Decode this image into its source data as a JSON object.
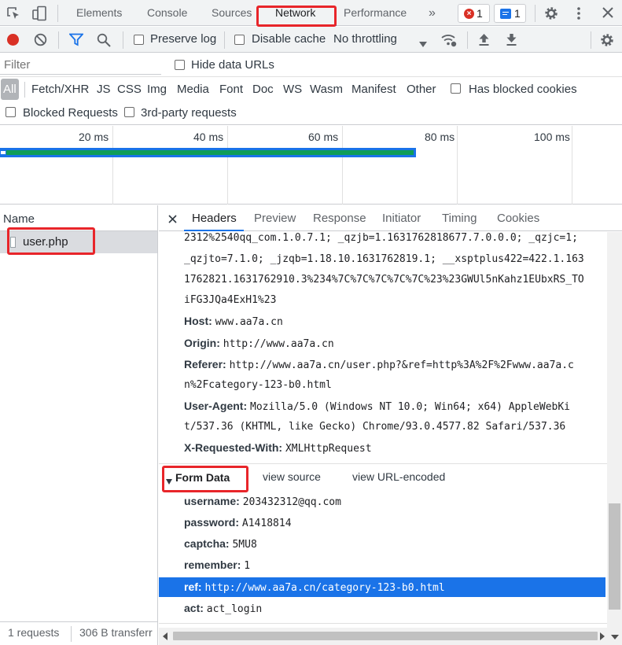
{
  "tabs": {
    "elements": "Elements",
    "console": "Console",
    "sources": "Sources",
    "network": "Network",
    "performance": "Performance",
    "more": "»",
    "error_count": "1",
    "message_count": "1"
  },
  "toolbar": {
    "preserve_log": "Preserve log",
    "disable_cache": "Disable cache",
    "throttling": "No throttling"
  },
  "filter": {
    "placeholder": "Filter",
    "hide_data_urls": "Hide data URLs"
  },
  "types": [
    "All",
    "Fetch/XHR",
    "JS",
    "CSS",
    "Img",
    "Media",
    "Font",
    "Doc",
    "WS",
    "Wasm",
    "Manifest",
    "Other"
  ],
  "has_blocked_cookies": "Has blocked cookies",
  "blocked_requests": "Blocked Requests",
  "third_party": "3rd-party requests",
  "timeline": {
    "ticks": [
      "20 ms",
      "40 ms",
      "60 ms",
      "80 ms",
      "100 ms"
    ]
  },
  "list": {
    "name_header": "Name",
    "request_name": "user.php"
  },
  "detail_tabs": [
    "Headers",
    "Preview",
    "Response",
    "Initiator",
    "Timing",
    "Cookies"
  ],
  "cookie_lines": [
    "2312%2540qq_com.1.0.7.1; _qzjb=1.1631762818677.7.0.0.0; _qzjc=1;",
    "_qzjto=7.1.0; _jzqb=1.18.10.1631762819.1; __xsptplus422=422.1.163",
    "1762821.1631762910.3%234%7C%7C%7C%7C%7C%23%23GWUl5nKahz1EUbxRS_TO",
    "iFG3JQa4ExH1%23"
  ],
  "headers": {
    "host_key": "Host:",
    "host_val": "www.aa7a.cn",
    "origin_key": "Origin:",
    "origin_val": "http://www.aa7a.cn",
    "referer_key": "Referer:",
    "referer_val1": "http://www.aa7a.cn/user.php?&ref=http%3A%2F%2Fwww.aa7a.c",
    "referer_val2": "n%2Fcategory-123-b0.html",
    "ua_key": "User-Agent:",
    "ua_val1": "Mozilla/5.0 (Windows NT 10.0; Win64; x64) AppleWebKi",
    "ua_val2": "t/537.36 (KHTML, like Gecko) Chrome/93.0.4577.82 Safari/537.36",
    "xrw_key": "X-Requested-With:",
    "xrw_val": "XMLHttpRequest"
  },
  "form_data": {
    "title": "Form Data",
    "view_source": "view source",
    "view_url_encoded": "view URL-encoded",
    "username_key": "username:",
    "username_val": "203432312@qq.com",
    "password_key": "password:",
    "password_val": "A1418814",
    "captcha_key": "captcha:",
    "captcha_val": "5MU8",
    "remember_key": "remember:",
    "remember_val": "1",
    "ref_key": "ref:",
    "ref_val": "http://www.aa7a.cn/category-123-b0.html",
    "act_key": "act:",
    "act_val": "act_login"
  },
  "status": {
    "requests": "1 requests",
    "transferred": "306 B transferr"
  },
  "colors": {
    "accent": "#1a73e8",
    "record": "#d93025",
    "selection": "#1a73e8",
    "annotation": "#e8252a"
  }
}
